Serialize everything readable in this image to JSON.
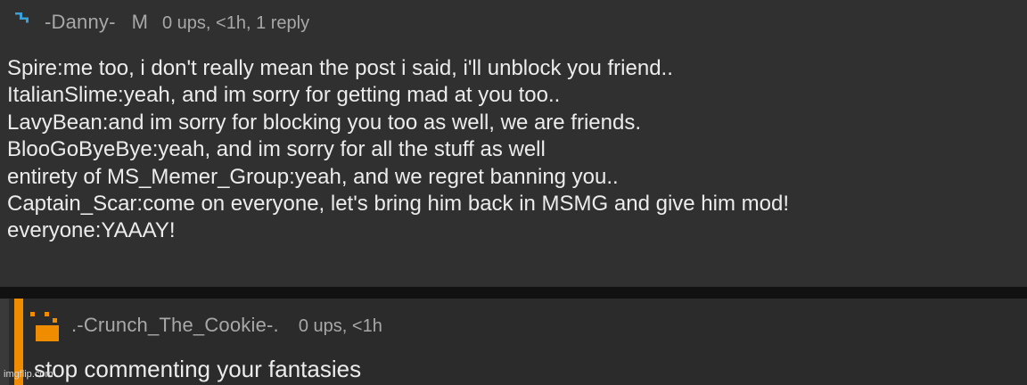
{
  "comment": {
    "username": "-Danny-",
    "badge": "M",
    "stats": "0 ups, <1h, 1 reply",
    "lines": [
      "Spire:me too, i don't really mean the post i said, i'll unblock you friend..",
      "ItalianSlime:yeah, and im sorry for getting mad at you too..",
      "LavyBean:and im sorry for blocking you too as well, we are friends.",
      "BlooGoByeBye:yeah, and im sorry for all the stuff as well",
      "entirety of MS_Memer_Group:yeah, and we regret banning you..",
      "Captain_Scar:come on everyone, let's bring him back in MSMG and give him mod!",
      "everyone:YAAAY!"
    ]
  },
  "reply": {
    "username": ".-Crunch_The_Cookie-.",
    "stats": "0 ups, <1h",
    "text": "stop commenting your fantasies"
  },
  "watermark": "imgflip.com",
  "colors": {
    "accent_orange": "#f08c00",
    "danny_avatar_blue": "#3aa0d8"
  },
  "icons": {
    "danny_avatar": "lightning-avatar-icon",
    "crunch_avatar": "pixel-cookie-avatar-icon"
  }
}
